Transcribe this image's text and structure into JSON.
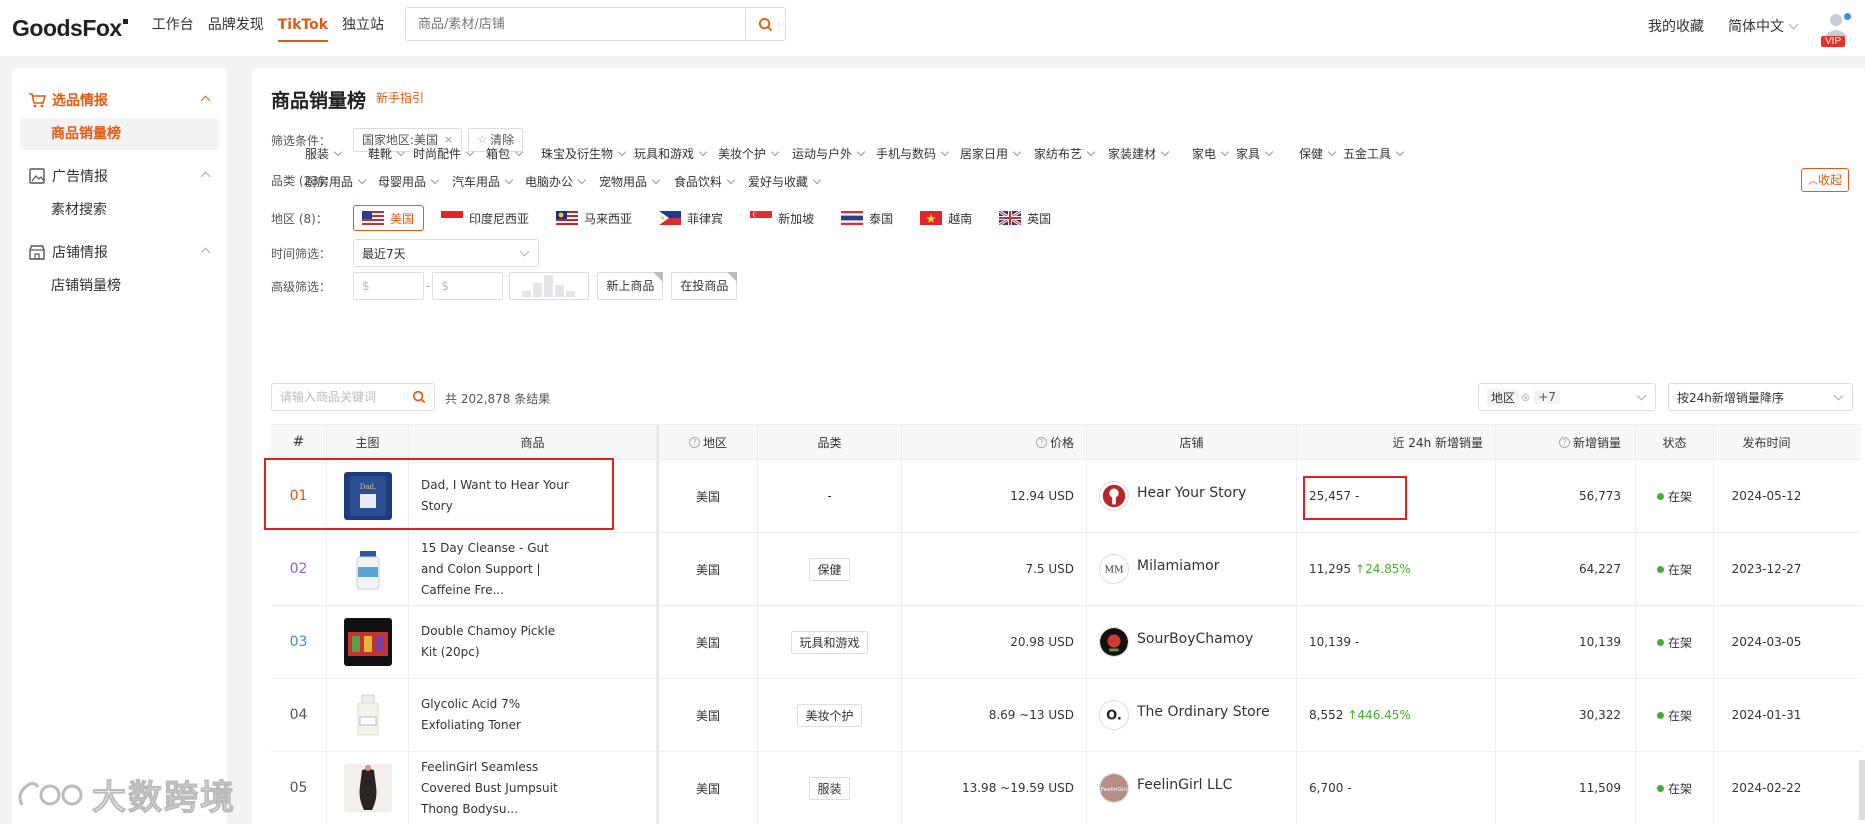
{
  "header": {
    "logo": "GoodsFox",
    "nav": [
      {
        "label": "工作台",
        "active": false
      },
      {
        "label": "品牌发现",
        "active": false
      },
      {
        "label": "TikTok",
        "active": true
      },
      {
        "label": "独立站",
        "active": false
      }
    ],
    "search_placeholder": "商品/素材/店铺",
    "favorites": "我的收藏",
    "language": "简体中文",
    "vip": "VIP"
  },
  "sidebar": {
    "groups": [
      {
        "label": "选品情报",
        "icon": "cart-icon",
        "active": true,
        "items": [
          {
            "label": "商品销量榜",
            "active": true
          }
        ]
      },
      {
        "label": "广告情报",
        "icon": "image-icon",
        "active": false,
        "items": [
          {
            "label": "素材搜索",
            "active": false
          }
        ]
      },
      {
        "label": "店铺情报",
        "icon": "store-icon",
        "active": false,
        "items": [
          {
            "label": "店铺销量榜",
            "active": false
          }
        ]
      }
    ]
  },
  "main": {
    "title": "商品销量榜",
    "guide": "新手指引",
    "filters": {
      "condition_label": "筛选条件：",
      "condition_chip": "国家地区:美国",
      "clear": "清除",
      "category_label": "品类 (23)：",
      "collapse": "收起",
      "categories_row1": [
        "服装",
        "鞋靴",
        "时尚配件",
        "箱包",
        "珠宝及衍生物",
        "玩具和游戏",
        "美妆个护",
        "运动与户外",
        "手机与数码",
        "居家日用",
        "家纺布艺",
        "家装建材",
        "家电",
        "家具",
        "保健",
        "五金工具"
      ],
      "categories_row2": [
        "厨房用品",
        "母婴用品",
        "汽车用品",
        "电脑办公",
        "宠物用品",
        "食品饮料",
        "爱好与收藏"
      ],
      "region_label": "地区 (8)：",
      "regions": [
        {
          "label": "美国",
          "selected": true,
          "flag": "us"
        },
        {
          "label": "印度尼西亚",
          "selected": false,
          "flag": "id"
        },
        {
          "label": "马来西亚",
          "selected": false,
          "flag": "my"
        },
        {
          "label": "菲律宾",
          "selected": false,
          "flag": "ph"
        },
        {
          "label": "新加坡",
          "selected": false,
          "flag": "sg"
        },
        {
          "label": "泰国",
          "selected": false,
          "flag": "th"
        },
        {
          "label": "越南",
          "selected": false,
          "flag": "vn"
        },
        {
          "label": "英国",
          "selected": false,
          "flag": "gb"
        }
      ],
      "time_label": "时间筛选：",
      "time_value": "最近7天",
      "advanced_label": "高级筛选：",
      "price_min_placeholder": "$",
      "price_max_placeholder": "$",
      "range_dash": "-",
      "new_products": "新上商品",
      "in_ads": "在投商品"
    },
    "keyword_placeholder": "请输入商品关键词",
    "result_count": "共 202,878 条结果",
    "region_filter": {
      "label": "地区",
      "extra": "+7"
    },
    "sort": "按24h新增销量降序",
    "table": {
      "headers": {
        "rank": "#",
        "image": "主图",
        "product": "商品",
        "region": "地区",
        "category": "品类",
        "price": "价格",
        "shop": "店铺",
        "sales24h": "近 24h 新增销量",
        "new_sales": "新增销量",
        "status": "状态",
        "date": "发布时间"
      },
      "rows": [
        {
          "rank": "01",
          "rank_color": "#e15b14",
          "product": "Dad, I Want to Hear Your Story",
          "region": "美国",
          "category": "-",
          "price": "12.94 USD",
          "shop": "Hear Your Story",
          "sales24h": "25,457",
          "growth": "-",
          "growth_up": false,
          "new_sales": "56,773",
          "status": "在架",
          "date": "2024-05-12"
        },
        {
          "rank": "02",
          "rank_color": "#8a62d6",
          "product": "15 Day Cleanse - Gut and Colon Support | Caffeine Fre...",
          "region": "美国",
          "category": "保健",
          "price": "7.5 USD",
          "shop": "Milamiamor",
          "sales24h": "11,295",
          "growth": "24.85%",
          "growth_up": true,
          "new_sales": "64,227",
          "status": "在架",
          "date": "2023-12-27"
        },
        {
          "rank": "03",
          "rank_color": "#3a8ee6",
          "product": "Double Chamoy Pickle Kit (20pc)",
          "region": "美国",
          "category": "玩具和游戏",
          "price": "20.98 USD",
          "shop": "SourBoyChamoy",
          "sales24h": "10,139",
          "growth": "-",
          "growth_up": false,
          "new_sales": "10,139",
          "status": "在架",
          "date": "2024-03-05"
        },
        {
          "rank": "04",
          "rank_color": "#555555",
          "product": "Glycolic Acid 7% Exfoliating Toner",
          "region": "美国",
          "category": "美妆个护",
          "price": "8.69 ~13 USD",
          "shop": "The Ordinary Store",
          "sales24h": "8,552",
          "growth": "446.45%",
          "growth_up": true,
          "new_sales": "30,322",
          "status": "在架",
          "date": "2024-01-31"
        },
        {
          "rank": "05",
          "rank_color": "#555555",
          "product": "FeelinGirl Seamless Covered Bust Jumpsuit Thong Bodysu...",
          "region": "美国",
          "category": "服装",
          "price": "13.98 ~19.59 USD",
          "shop": "FeelinGirl LLC",
          "sales24h": "6,700",
          "growth": "-",
          "growth_up": false,
          "new_sales": "11,509",
          "status": "在架",
          "date": "2024-02-22"
        }
      ]
    }
  },
  "watermark": "大数跨境",
  "colors": {
    "accent": "#e15b14",
    "highlight": "#e02020",
    "status_green": "#43b02a"
  }
}
